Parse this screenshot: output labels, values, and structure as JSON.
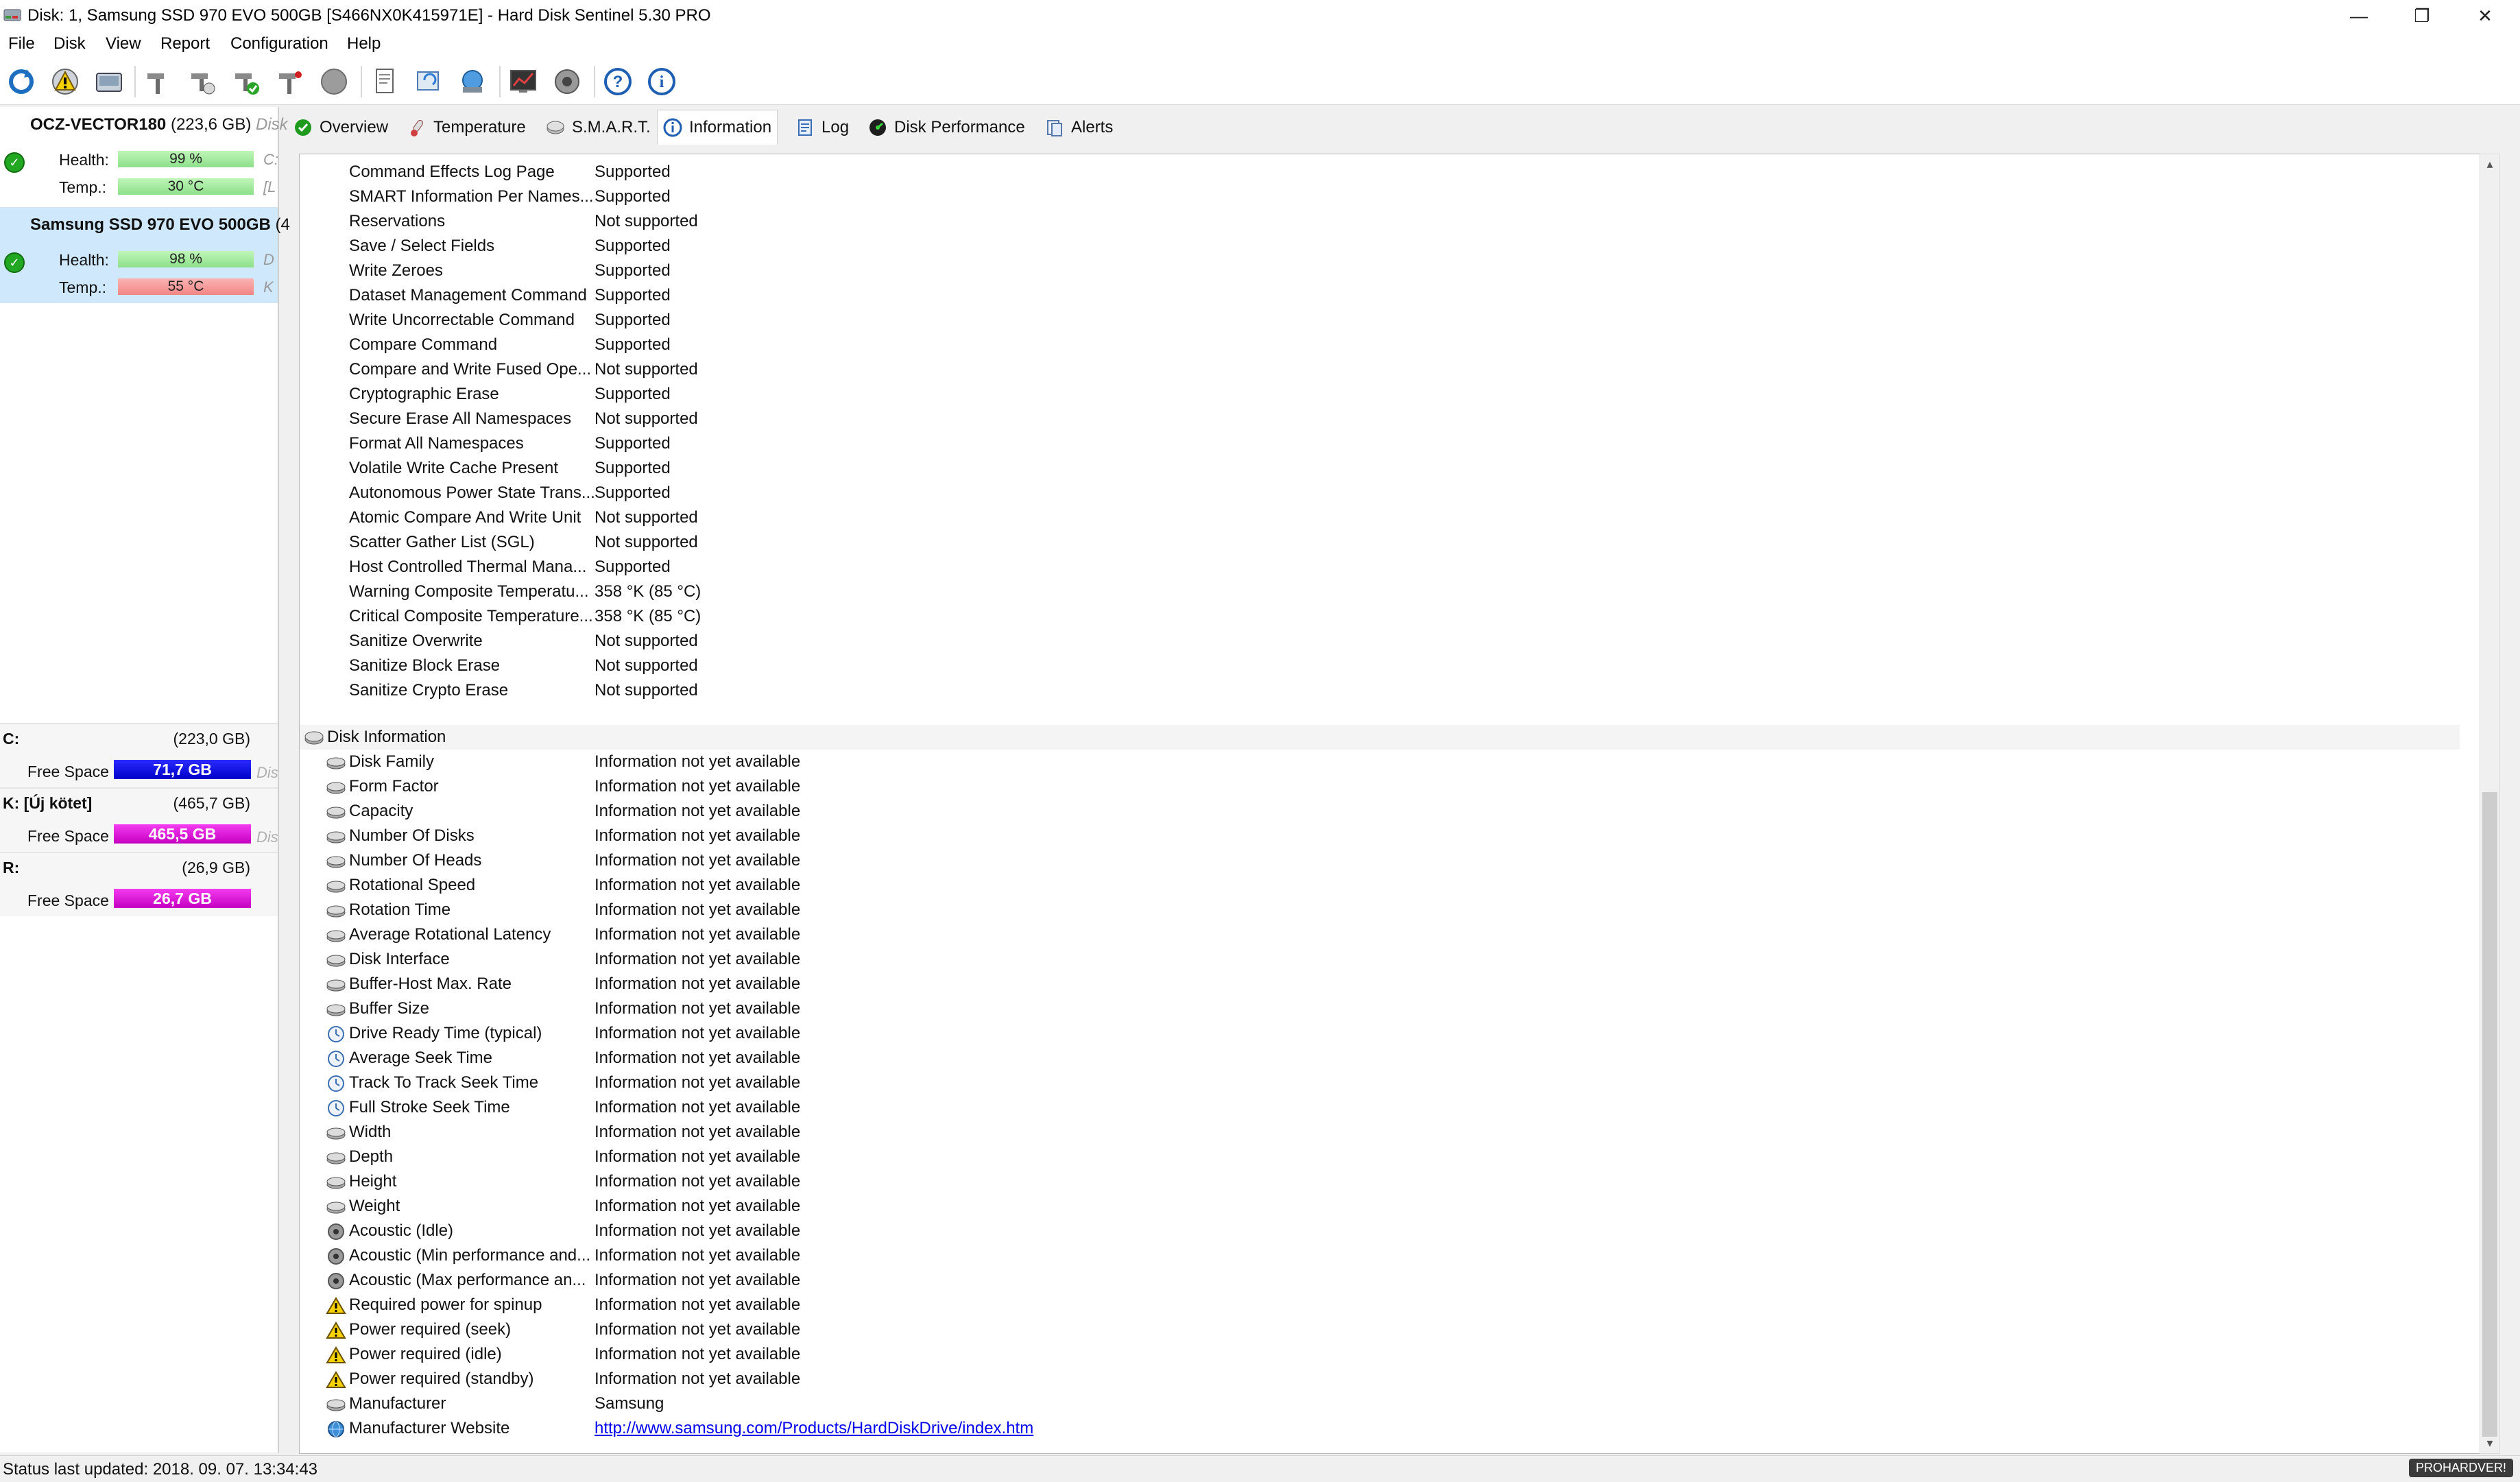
{
  "window": {
    "title": "Disk: 1, Samsung SSD 970 EVO 500GB [S466NX0K415971E]  -  Hard Disk Sentinel 5.30 PRO",
    "minimize_glyph": "—",
    "restore_glyph": "❐",
    "close_glyph": "✕"
  },
  "menu": [
    "File",
    "Disk",
    "View",
    "Report",
    "Configuration",
    "Help"
  ],
  "disks": [
    {
      "name": "OCZ-VECTOR180",
      "size": "(223,6 GB)",
      "extra": "Disk",
      "health_label": "Health:",
      "health": "99 %",
      "temp_label": "Temp.:",
      "temp": "30 °C",
      "cut1": "C:",
      "cut2": "[L"
    },
    {
      "name": "Samsung SSD 970 EVO 500GB",
      "size": "(4",
      "extra": "",
      "health_label": "Health:",
      "health": "98 %",
      "temp_label": "Temp.:",
      "temp": "55 °C",
      "cut1": "D",
      "cut2": "K"
    }
  ],
  "volumes": [
    {
      "letter": "C:",
      "size": "(223,0 GB)",
      "free_label": "Free Space",
      "free": "71,7 GB",
      "cut": "Dis"
    },
    {
      "letter": "K: [Új kötet]",
      "size": "(465,7 GB)",
      "free_label": "Free Space",
      "free": "465,5 GB",
      "cut": "Dis"
    },
    {
      "letter": "R:",
      "size": "(26,9 GB)",
      "free_label": "Free Space",
      "free": "26,7 GB",
      "cut": ""
    }
  ],
  "tabs": [
    "Overview",
    "Temperature",
    "S.M.A.R.T.",
    "Information",
    "Log",
    "Disk Performance",
    "Alerts"
  ],
  "features": [
    {
      "name": "Command Effects Log Page",
      "value": "Supported"
    },
    {
      "name": "SMART Information Per Names...",
      "value": "Supported"
    },
    {
      "name": "Reservations",
      "value": "Not supported"
    },
    {
      "name": "Save / Select Fields",
      "value": "Supported"
    },
    {
      "name": "Write Zeroes",
      "value": "Supported"
    },
    {
      "name": "Dataset Management Command",
      "value": "Supported"
    },
    {
      "name": "Write Uncorrectable Command",
      "value": "Supported"
    },
    {
      "name": "Compare Command",
      "value": "Supported"
    },
    {
      "name": "Compare and Write Fused Ope...",
      "value": "Not supported"
    },
    {
      "name": "Cryptographic Erase",
      "value": "Supported"
    },
    {
      "name": "Secure Erase All Namespaces",
      "value": "Not supported"
    },
    {
      "name": "Format All Namespaces",
      "value": "Supported"
    },
    {
      "name": "Volatile Write Cache Present",
      "value": "Supported"
    },
    {
      "name": "Autonomous Power State Trans...",
      "value": "Supported"
    },
    {
      "name": "Atomic Compare And Write Unit",
      "value": "Not supported"
    },
    {
      "name": "Scatter Gather List (SGL)",
      "value": "Not supported"
    },
    {
      "name": "Host Controlled Thermal Mana...",
      "value": "Supported"
    },
    {
      "name": "Warning Composite Temperatu...",
      "value": "358 °K (85 °C)"
    },
    {
      "name": "Critical Composite Temperature...",
      "value": "358 °K (85 °C)"
    },
    {
      "name": "Sanitize Overwrite",
      "value": "Not supported"
    },
    {
      "name": "Sanitize Block Erase",
      "value": "Not supported"
    },
    {
      "name": "Sanitize Crypto Erase",
      "value": "Not supported"
    }
  ],
  "disk_info_section": "Disk Information",
  "disk_info": [
    {
      "name": "Disk Family",
      "value": "Information not yet available",
      "icon": "disk-icon"
    },
    {
      "name": "Form Factor",
      "value": "Information not yet available",
      "icon": "disk-icon"
    },
    {
      "name": "Capacity",
      "value": "Information not yet available",
      "icon": "disk-icon"
    },
    {
      "name": "Number Of Disks",
      "value": "Information not yet available",
      "icon": "disk-icon"
    },
    {
      "name": "Number Of Heads",
      "value": "Information not yet available",
      "icon": "disk-icon"
    },
    {
      "name": "Rotational Speed",
      "value": "Information not yet available",
      "icon": "disk-icon"
    },
    {
      "name": "Rotation Time",
      "value": "Information not yet available",
      "icon": "disk-icon"
    },
    {
      "name": "Average Rotational Latency",
      "value": "Information not yet available",
      "icon": "disk-icon"
    },
    {
      "name": "Disk Interface",
      "value": "Information not yet available",
      "icon": "disk-icon"
    },
    {
      "name": "Buffer-Host Max. Rate",
      "value": "Information not yet available",
      "icon": "disk-icon"
    },
    {
      "name": "Buffer Size",
      "value": "Information not yet available",
      "icon": "disk-icon"
    },
    {
      "name": "Drive Ready Time (typical)",
      "value": "Information not yet available",
      "icon": "clock-icon"
    },
    {
      "name": "Average Seek Time",
      "value": "Information not yet available",
      "icon": "clock-icon"
    },
    {
      "name": "Track To Track Seek Time",
      "value": "Information not yet available",
      "icon": "clock-icon"
    },
    {
      "name": "Full Stroke Seek Time",
      "value": "Information not yet available",
      "icon": "clock-icon"
    },
    {
      "name": "Width",
      "value": "Information not yet available",
      "icon": "disk-icon"
    },
    {
      "name": "Depth",
      "value": "Information not yet available",
      "icon": "disk-icon"
    },
    {
      "name": "Height",
      "value": "Information not yet available",
      "icon": "disk-icon"
    },
    {
      "name": "Weight",
      "value": "Information not yet available",
      "icon": "disk-icon"
    },
    {
      "name": "Acoustic (Idle)",
      "value": "Information not yet available",
      "icon": "speaker-icon"
    },
    {
      "name": "Acoustic (Min performance and...",
      "value": "Information not yet available",
      "icon": "speaker-icon"
    },
    {
      "name": "Acoustic (Max performance an...",
      "value": "Information not yet available",
      "icon": "speaker-icon"
    },
    {
      "name": "Required power for spinup",
      "value": "Information not yet available",
      "icon": "warning-icon"
    },
    {
      "name": "Power required (seek)",
      "value": "Information not yet available",
      "icon": "warning-icon"
    },
    {
      "name": "Power required (idle)",
      "value": "Information not yet available",
      "icon": "warning-icon"
    },
    {
      "name": "Power required (standby)",
      "value": "Information not yet available",
      "icon": "warning-icon"
    },
    {
      "name": "Manufacturer",
      "value": "Samsung",
      "icon": "disk-icon"
    },
    {
      "name": "Manufacturer Website",
      "value": "http://www.samsung.com/Products/HardDiskDrive/index.htm",
      "icon": "globe-icon",
      "link": true
    }
  ],
  "status": "Status last updated: 2018. 09. 07. 13:34:43",
  "watermark": "PROHARDVER!"
}
